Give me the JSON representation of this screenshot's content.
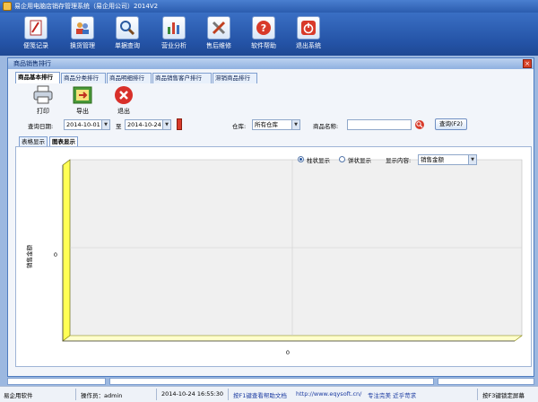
{
  "app": {
    "title": "易企用电脑店销存管理系统（易企用公司）2014V2"
  },
  "toolbar": {
    "items": [
      {
        "label": "便笺记录",
        "icon": "notepad-icon"
      },
      {
        "label": "换货管理",
        "icon": "people-icon"
      },
      {
        "label": "单据查询",
        "icon": "magnifier-icon"
      },
      {
        "label": "营业分析",
        "icon": "bar-chart-icon"
      },
      {
        "label": "售后维修",
        "icon": "tools-icon"
      },
      {
        "label": "软件帮助",
        "icon": "help-icon"
      },
      {
        "label": "退出系统",
        "icon": "power-icon"
      }
    ]
  },
  "window": {
    "title": "商品销售排行",
    "close_glyph": "×"
  },
  "tabs": [
    "商品基本排行",
    "商品分类排行",
    "商品明细排行",
    "商品销售客户排行",
    "滞销商品排行"
  ],
  "actions": {
    "print": "打印",
    "export": "导出",
    "exit": "退出"
  },
  "query": {
    "date_label": "查询日期:",
    "date_from": "2014-10-01",
    "to_label": "至",
    "date_to": "2014-10-24",
    "warehouse_label": "仓库:",
    "warehouse_value": "所有仓库",
    "product_label": "商品名称:",
    "product_value": "",
    "query_button": "查询(F2)"
  },
  "view_tabs": {
    "table": "表格显示",
    "chart": "图表显示"
  },
  "chart_options": {
    "bar_option": "柱状显示",
    "pie_option": "饼状显示",
    "content_label": "显示内容:",
    "content_value": "销售金额"
  },
  "chart_data": {
    "type": "bar",
    "categories": [],
    "values": [],
    "ylabel": "销售金额",
    "y_tick": "0",
    "x_tick": "0",
    "grid": true
  },
  "status": {
    "company": "易企用软件",
    "operator": "操作员：admin",
    "datetime": "2014-10-24 16:55:30",
    "help": "按F1键查看帮助文档",
    "url": "http://www.eqysoft.cn/",
    "slogan": "专注完美 近乎苛求",
    "lock": "按F3键锁定屏幕"
  },
  "colors": {
    "accent": "#2b5cae",
    "wall": "#ffff66",
    "panel": "#f2f5fa"
  }
}
